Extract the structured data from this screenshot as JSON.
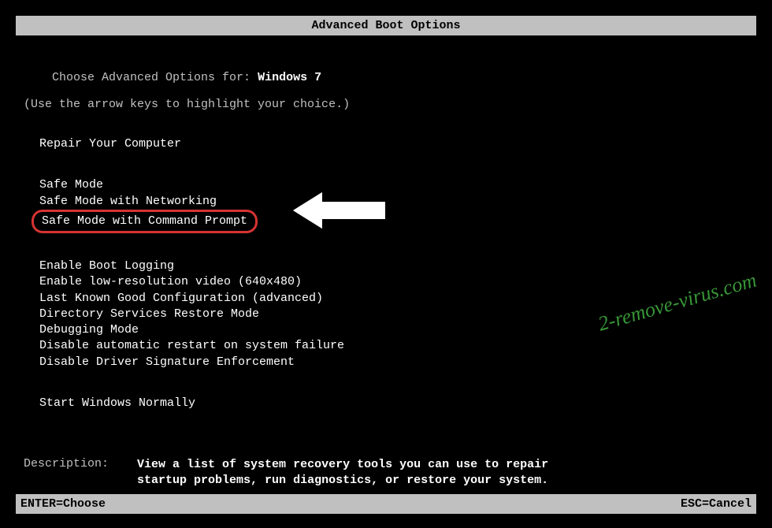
{
  "title": "Advanced Boot Options",
  "intro": {
    "prefix": "Choose Advanced Options for: ",
    "os": "Windows 7",
    "instruction": "(Use the arrow keys to highlight your choice.)"
  },
  "menu": {
    "repair": "Repair Your Computer",
    "safe_modes": [
      "Safe Mode",
      "Safe Mode with Networking",
      "Safe Mode with Command Prompt"
    ],
    "advanced": [
      "Enable Boot Logging",
      "Enable low-resolution video (640x480)",
      "Last Known Good Configuration (advanced)",
      "Directory Services Restore Mode",
      "Debugging Mode",
      "Disable automatic restart on system failure",
      "Disable Driver Signature Enforcement"
    ],
    "normal": "Start Windows Normally"
  },
  "description": {
    "label": "Description:    ",
    "text": "View a list of system recovery tools you can use to repair startup problems, run diagnostics, or restore your system."
  },
  "footer": {
    "enter": "ENTER=Choose",
    "esc": "ESC=Cancel"
  },
  "watermark": "2-remove-virus.com",
  "highlight_index": 2
}
